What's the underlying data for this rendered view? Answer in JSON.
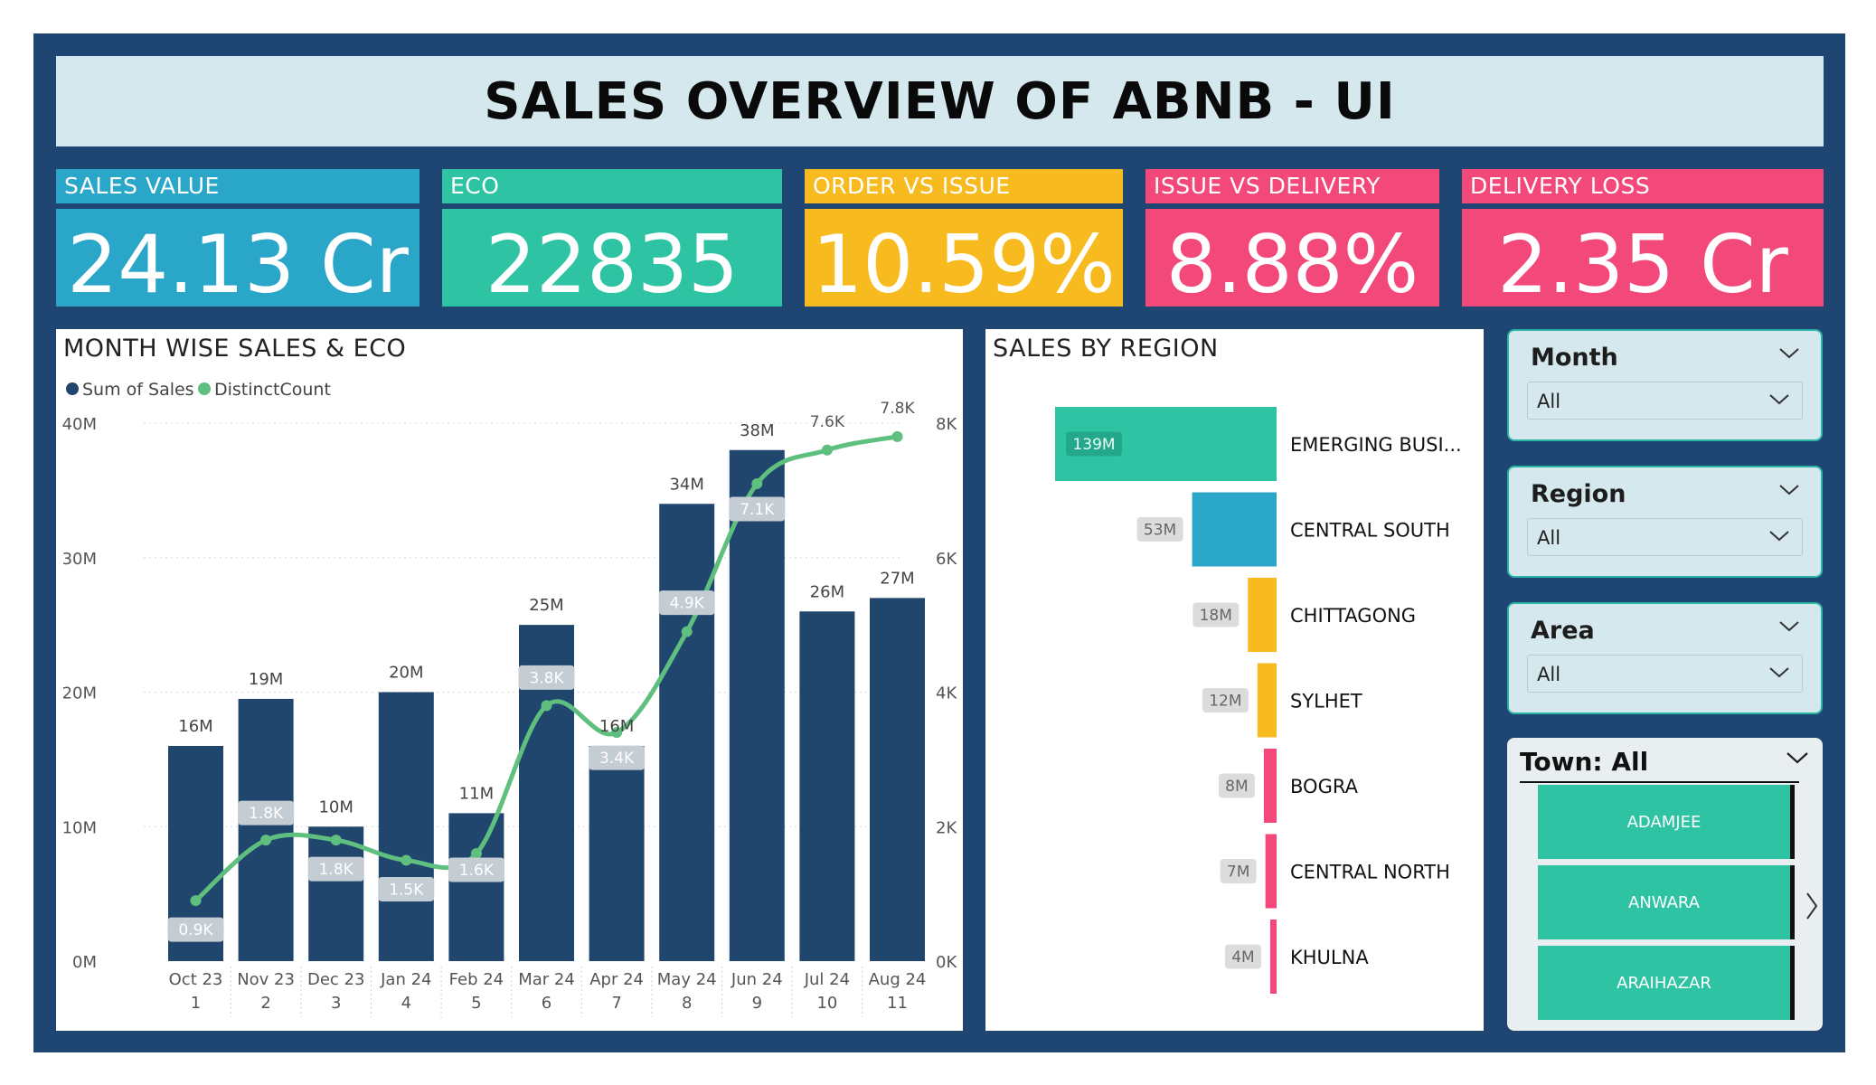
{
  "title": "SALES OVERVIEW OF ABNB - UI",
  "kpis": [
    {
      "label": "SALES VALUE",
      "value": "24.13 Cr",
      "color": "#2aa6c8"
    },
    {
      "label": "ECO",
      "value": "22835",
      "color": "#2ec4a3"
    },
    {
      "label": "ORDER VS ISSUE",
      "value": "10.59%",
      "color": "#f7bb1f"
    },
    {
      "label": "ISSUE VS DELIVERY",
      "value": "8.88%",
      "color": "#f2487a"
    },
    {
      "label": "DELIVERY LOSS",
      "value": "2.35 Cr",
      "color": "#f2487a"
    }
  ],
  "month_chart": {
    "title": "MONTH WISE SALES & ECO",
    "legend": [
      {
        "name": "Sum of Sales",
        "color": "#20466e"
      },
      {
        "name": "DistinctCount",
        "color": "#5fbf7f"
      }
    ]
  },
  "region_chart": {
    "title": "SALES BY REGION"
  },
  "slicers": [
    {
      "title": "Month",
      "value": "All"
    },
    {
      "title": "Region",
      "value": "All"
    },
    {
      "title": "Area",
      "value": "All"
    }
  ],
  "town": {
    "title": "Town: All",
    "items": [
      "ADAMJEE",
      "ANWARA",
      "ARAIHAZAR"
    ]
  },
  "chart_data": [
    {
      "type": "bar",
      "title": "MONTH WISE SALES & ECO",
      "categories": [
        "Oct 23",
        "Nov 23",
        "Dec 23",
        "Jan 24",
        "Feb 24",
        "Mar 24",
        "Apr 24",
        "May 24",
        "Jun 24",
        "Jul 24",
        "Aug 24"
      ],
      "sub_categories": [
        "1",
        "2",
        "3",
        "4",
        "5",
        "6",
        "7",
        "8",
        "9",
        "10",
        "11"
      ],
      "series": [
        {
          "name": "Sum of Sales",
          "type": "bar",
          "axis": "left",
          "values": [
            16000000,
            19500000,
            10000000,
            20000000,
            11000000,
            25000000,
            16000000,
            34000000,
            38000000,
            26000000,
            27000000
          ],
          "labels": [
            "16M",
            "19M",
            "10M",
            "20M",
            "11M",
            "25M",
            "16M",
            "34M",
            "38M",
            "26M",
            "27M"
          ]
        },
        {
          "name": "DistinctCount",
          "type": "line",
          "axis": "right",
          "values": [
            900,
            1800,
            1800,
            1500,
            1600,
            3800,
            3400,
            4900,
            7100,
            7600,
            7800
          ],
          "labels": [
            "0.9K",
            "1.8K",
            "1.8K",
            "1.5K",
            "1.6K",
            "3.8K",
            "3.4K",
            "4.9K",
            "7.1K",
            "7.6K",
            "7.8K"
          ]
        }
      ],
      "y_left": {
        "ylim": [
          0,
          40000000
        ],
        "ticks": [
          0,
          10000000,
          20000000,
          30000000,
          40000000
        ],
        "tick_labels": [
          "0M",
          "10M",
          "20M",
          "30M",
          "40M"
        ]
      },
      "y_right": {
        "ylim": [
          0,
          8000
        ],
        "ticks": [
          0,
          2000,
          4000,
          6000,
          8000
        ],
        "tick_labels": [
          "0K",
          "2K",
          "4K",
          "6K",
          "8K"
        ]
      },
      "grid": true,
      "legend_position": "top-left"
    },
    {
      "type": "bar",
      "orientation": "horizontal",
      "title": "SALES BY REGION",
      "categories": [
        "EMERGING BUSI...",
        "CENTRAL SOUTH",
        "CHITTAGONG",
        "SYLHET",
        "BOGRA",
        "CENTRAL NORTH",
        "KHULNA"
      ],
      "values": [
        139000000,
        53000000,
        18000000,
        12000000,
        8000000,
        7000000,
        4000000
      ],
      "labels": [
        "139M",
        "53M",
        "18M",
        "12M",
        "8M",
        "7M",
        "4M"
      ],
      "colors": [
        "#2ec4a3",
        "#2aa6c8",
        "#f7bb1f",
        "#f7bb1f",
        "#f2487a",
        "#f2487a",
        "#f2487a"
      ]
    }
  ]
}
